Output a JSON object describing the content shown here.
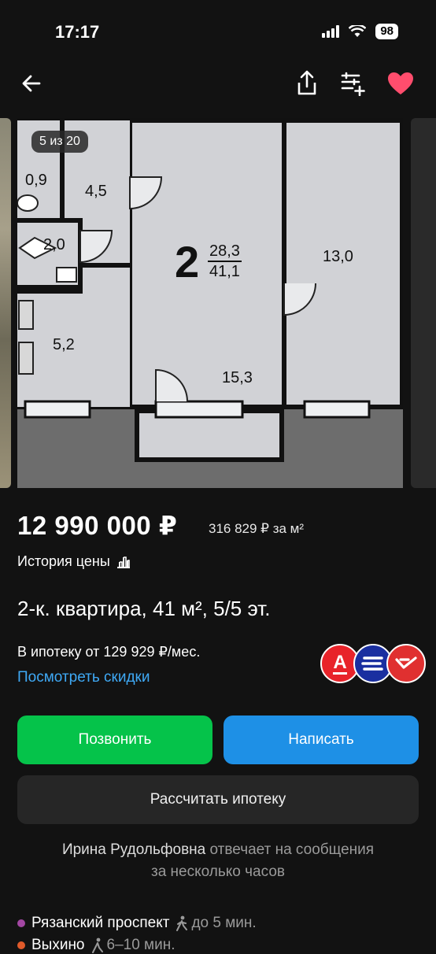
{
  "status_bar": {
    "time": "17:17",
    "battery": "98"
  },
  "nav": {
    "back": "arrow-left-icon",
    "share": "share-icon",
    "compare": "compare-icon",
    "favorite": "heart-icon",
    "favorite_color": "#ff4d6d"
  },
  "gallery": {
    "counter": "5 из 20",
    "rooms": {
      "r1": "0,9",
      "r2": "4,5",
      "r3": "2,0",
      "r4": "5,2",
      "rooms_count": "2",
      "living": "28,3",
      "total": "41,1",
      "r5": "13,0",
      "r6": "15,3"
    }
  },
  "listing": {
    "price": "12 990 000 ₽",
    "price_per_m2": "316 829 ₽ за м²",
    "price_history": "История цены",
    "title": "2-к. квартира, 41 м², 5/5 эт.",
    "mortgage_from": "В ипотеку от 129 929 ₽/мес.",
    "discounts_link": "Посмотреть скидки"
  },
  "banks": [
    {
      "name": "alfa-bank-icon",
      "color": "#e8232a",
      "glyph": "А"
    },
    {
      "name": "bank-blue-icon",
      "color": "#1a2fa0",
      "glyph": ""
    },
    {
      "name": "bank-red-icon",
      "color": "#e03030",
      "glyph": ""
    }
  ],
  "actions": {
    "call": "Позвонить",
    "write": "Написать",
    "calc": "Рассчитать ипотеку",
    "call_color": "#05c34a",
    "write_color": "#1e90e6"
  },
  "seller": {
    "name": "Ирина Рудольфовна",
    "response_line1": " отвечает на сообщения",
    "response_line2": "за несколько часов"
  },
  "metro": [
    {
      "station": "Рязанский проспект",
      "time": "до 5 мин.",
      "color": "#a347a3"
    },
    {
      "station": "Выхино",
      "time": "6–10 мин.",
      "color": "#e05a2a"
    }
  ]
}
